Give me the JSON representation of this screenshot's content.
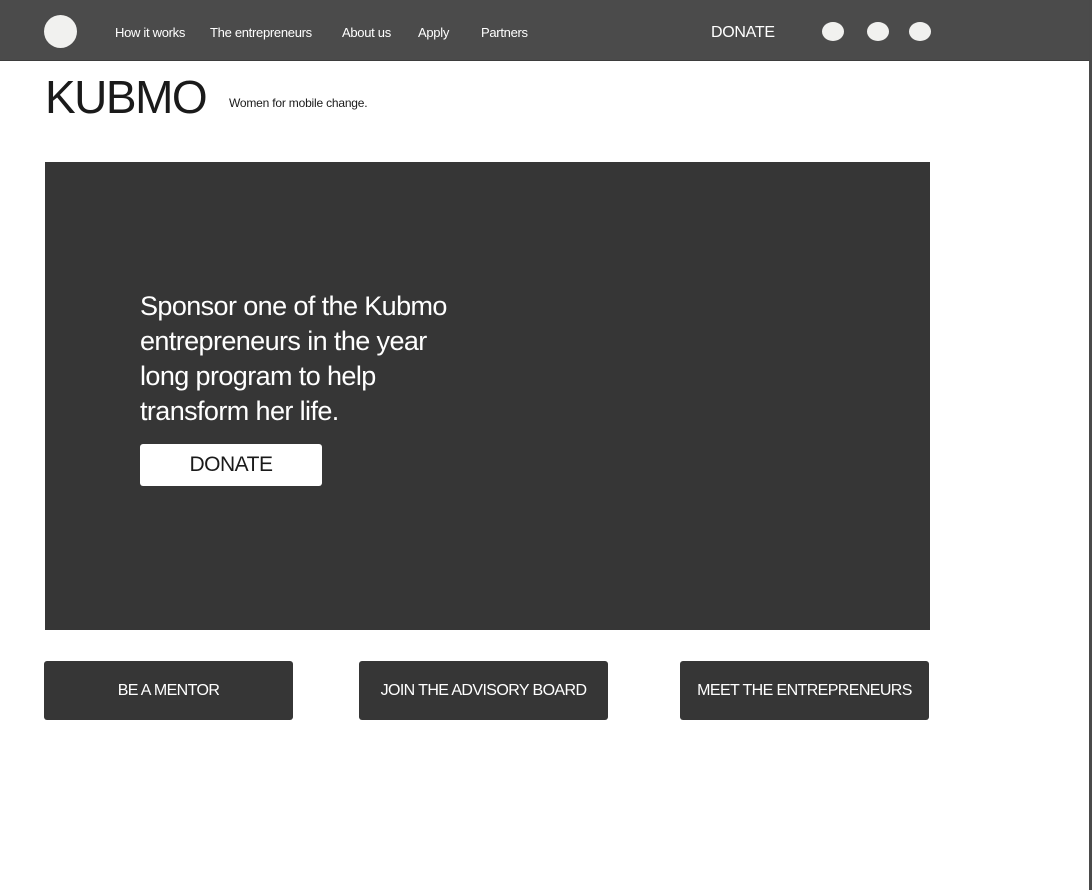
{
  "nav": {
    "links": [
      {
        "label": "How it works"
      },
      {
        "label": "The entrepreneurs"
      },
      {
        "label": "About us"
      },
      {
        "label": "Apply"
      },
      {
        "label": "Partners"
      }
    ],
    "donate_label": "DONATE",
    "social_icons": [
      "social-icon",
      "social-icon",
      "social-icon"
    ]
  },
  "brand": {
    "title": "KUBMO",
    "tagline": "Women for mobile change."
  },
  "hero": {
    "text": "Sponsor one of the Kubmo entrepreneurs in the year long program to help transform her life.",
    "button_label": "DONATE"
  },
  "cta": {
    "mentor_label": "BE A MENTOR",
    "advisory_label": "JOIN THE ADVISORY BOARD",
    "entrepreneurs_label": "MEET THE ENTREPRENEURS"
  },
  "colors": {
    "topbar": "#4b4b4b",
    "hero": "#363636",
    "button_dark": "#363636",
    "light": "#f1f1ef"
  }
}
